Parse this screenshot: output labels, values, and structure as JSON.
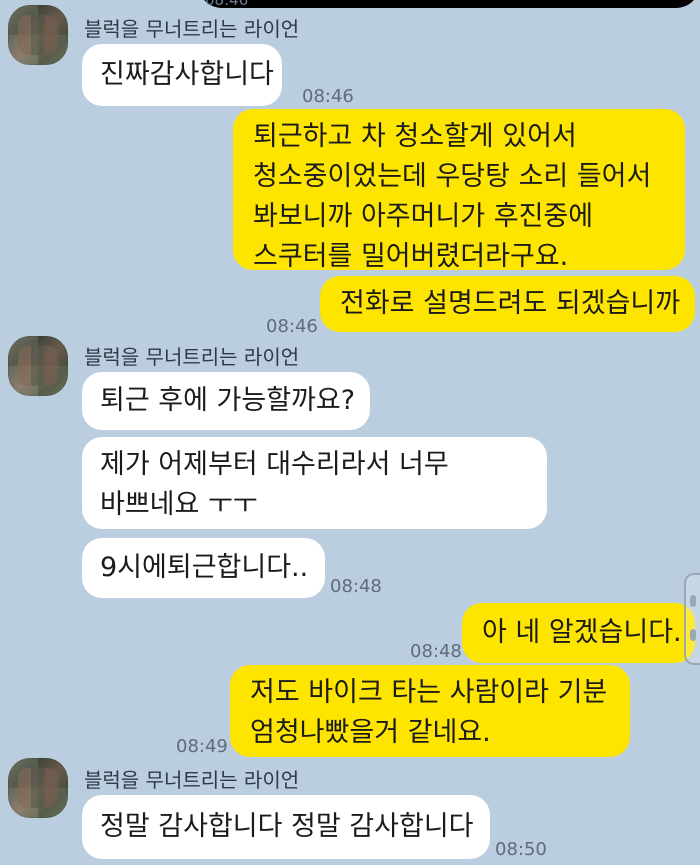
{
  "chat": {
    "top_partial_time": "08:46",
    "sender_name": "블럭을 무너트리는 라이언",
    "messages": [
      {
        "id": "m1",
        "text": "진짜감사합니다",
        "time": "08:46"
      },
      {
        "id": "m2",
        "text": "퇴근하고 차 청소할게 있어서\n청소중이었는데 우당탕 소리 들어서\n봐보니까 아주머니가 후진중에\n스쿠터를 밀어버렸더라구요."
      },
      {
        "id": "m3",
        "text": "전화로 설명드려도 되겠습니까",
        "time": "08:46"
      },
      {
        "id": "m4",
        "text": "퇴근 후에 가능할까요?"
      },
      {
        "id": "m5",
        "text": "제가 어제부터 대수리라서 너무\n바쁘네요 ㅜㅜ"
      },
      {
        "id": "m6",
        "text": "9시에퇴근합니다..",
        "time": "08:48"
      },
      {
        "id": "m7",
        "text": "아 네 알겠습니다.",
        "time": "08:48"
      },
      {
        "id": "m8",
        "text": "저도 바이크 타는 사람이라 기분\n엄청나빴을거 같네요.",
        "time": "08:49"
      },
      {
        "id": "m9",
        "text": "정말 감사합니다 정말 감사합니다",
        "time": "08:50"
      }
    ]
  }
}
